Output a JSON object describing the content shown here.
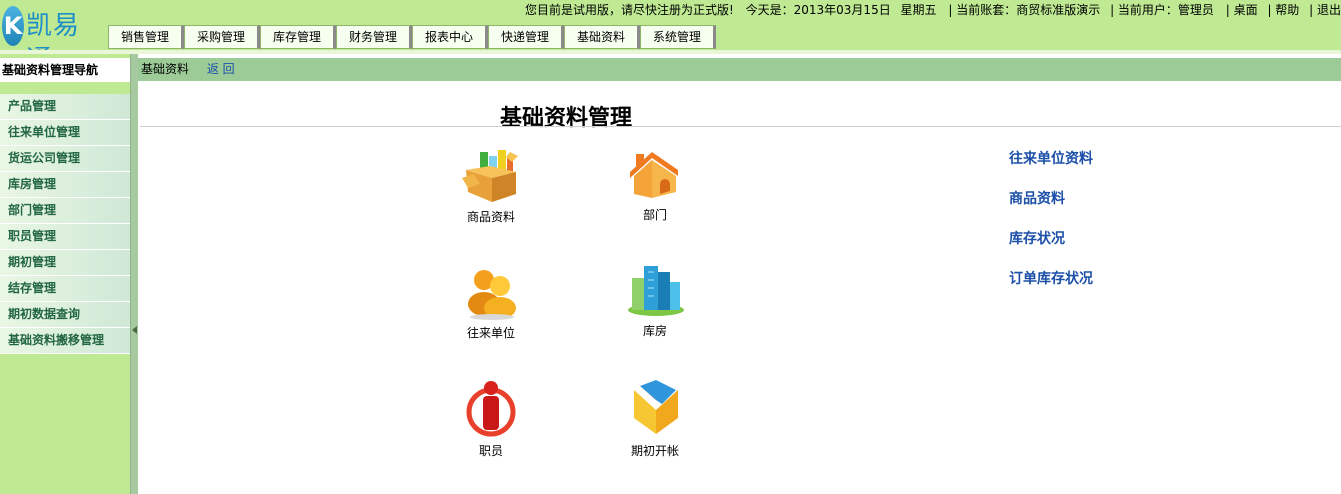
{
  "app": {
    "logo_letter": "K",
    "logo_text": "凯易通"
  },
  "topbar": {
    "notice": "您目前是试用版，请尽快注册为正式版!",
    "today": "今天是：2013年03月15日",
    "weekday": "星期五",
    "account": "| 当前账套：商贸标准版演示",
    "user": "| 当前用户：管理员",
    "desktop": "| 桌面",
    "help": "| 帮助",
    "exit": "| 退出"
  },
  "tabs": [
    "销售管理",
    "采购管理",
    "库存管理",
    "财务管理",
    "报表中心",
    "快递管理",
    "基础资料",
    "系统管理"
  ],
  "sidebar": {
    "title": "基础资料管理导航",
    "items": [
      "产品管理",
      "往来单位管理",
      "货运公司管理",
      "库房管理",
      "部门管理",
      "职员管理",
      "期初管理",
      "结存管理",
      "期初数据查询",
      "基础资料搬移管理"
    ]
  },
  "breadcrumb": {
    "current": "基础资料",
    "back": "返 回"
  },
  "main": {
    "title": "基础资料管理",
    "tiles": [
      {
        "label": "商品资料",
        "icon": "goods-box-icon"
      },
      {
        "label": "部门",
        "icon": "house-icon"
      },
      {
        "label": "往来单位",
        "icon": "people-icon"
      },
      {
        "label": "库房",
        "icon": "buildings-icon"
      },
      {
        "label": "职员",
        "icon": "person-icon"
      },
      {
        "label": "期初开帐",
        "icon": "folder-icon"
      }
    ],
    "quick_links": [
      "往来单位资料",
      "商品资料",
      "库存状况",
      "订单库存状况"
    ]
  },
  "colors": {
    "header_green": "#bfe993",
    "breadcrumb_green": "#9ccb98",
    "link_blue": "#1b4fa8"
  }
}
